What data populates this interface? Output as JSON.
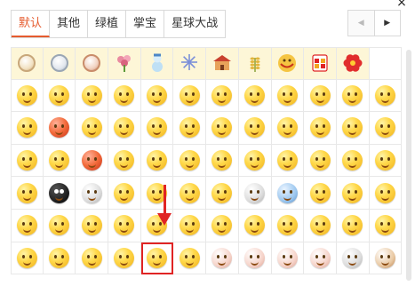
{
  "tabs": [
    {
      "label": "默认",
      "active": true
    },
    {
      "label": "其他",
      "active": false
    },
    {
      "label": "绿植",
      "active": false
    },
    {
      "label": "掌宝",
      "active": false
    },
    {
      "label": "星球大战",
      "active": false
    }
  ],
  "close_glyph": "×",
  "pager": {
    "prev_glyph": "◀",
    "next_glyph": "▶"
  },
  "colors": {
    "accent": "#e55b2e",
    "special_row_bg": "#fdf6d7",
    "highlight": "#e02424"
  },
  "special_row": [
    "gold-medal-icon",
    "silver-medal-icon",
    "bronze-medal-icon",
    "flower-bouquet-icon",
    "snowman-icon",
    "fireworks-icon",
    "temple-icon",
    "wheat-icon",
    "noodles-icon",
    "calendar-2021-icon",
    "red-flower-icon"
  ],
  "emoji_rows": [
    [
      "smile",
      "grin",
      "blush",
      "cry-laugh",
      "laugh",
      "big-grin",
      "teary-laugh",
      "smirk",
      "happy",
      "sweat",
      "laugh-tears",
      "sly"
    ],
    [
      "dizzy",
      "angry-red",
      "pout",
      "shy",
      "sneer",
      "surprised",
      "crying",
      "side-eye",
      "facepalm",
      "cover-face",
      "hug",
      "think"
    ],
    [
      "heart-eyes",
      "flushed",
      "kiss-red",
      "wink",
      "tongue",
      "content",
      "sunglasses",
      "nerd",
      "sleepy",
      "hmm",
      "cheeky",
      "doubt"
    ],
    [
      "confused",
      "black-face",
      "skull",
      "pensive",
      "shush",
      "shock",
      "grimace",
      "mask",
      "cold",
      "yawn",
      "angry",
      "nervous"
    ],
    [
      "eye-roll",
      "sleepy-tear",
      "cool-shades",
      "rage",
      "gulp",
      "victory",
      "hammer",
      "fortune",
      "money-eyes",
      "cheers",
      "drool",
      "sweat-drop"
    ],
    [
      "sneeze",
      "grateful",
      "clap",
      "ok",
      "weeping",
      "wow",
      "pig",
      "pig-laugh",
      "pig-cute",
      "pig-smile",
      "panda",
      "cat"
    ]
  ],
  "highlighted_emoji": "weeping"
}
